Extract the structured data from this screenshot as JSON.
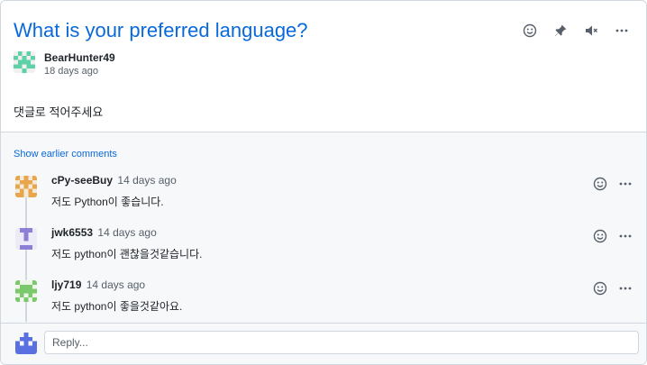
{
  "discussion": {
    "title": "What is your preferred language?",
    "author": "BearHunter49",
    "time": "18 days ago",
    "body": "댓글로 적어주세요"
  },
  "actions": {
    "emoji_icon": "smiley-icon",
    "pin_icon": "pin-icon",
    "mute_icon": "mute-icon",
    "more_icon": "kebab-horizontal-icon"
  },
  "comments_section": {
    "show_earlier": "Show earlier comments",
    "items": [
      {
        "author": "cPy-seeBuy",
        "time": "14 days ago",
        "text": "저도 Python이 좋습니다.",
        "avatar_color": "#e8a54b"
      },
      {
        "author": "jwk6553",
        "time": "14 days ago",
        "text": "저도 python이 괜찮을것같습니다.",
        "avatar_color": "#8b7fd6"
      },
      {
        "author": "ljy719",
        "time": "14 days ago",
        "text": "저도 python이 좋을것같아요.",
        "avatar_color": "#7cc96d"
      }
    ]
  },
  "reply": {
    "placeholder": "Reply..."
  },
  "colors": {
    "link": "#0969da",
    "border": "#d0d7de",
    "muted": "#57606a",
    "surface": "#f6f8fa"
  }
}
